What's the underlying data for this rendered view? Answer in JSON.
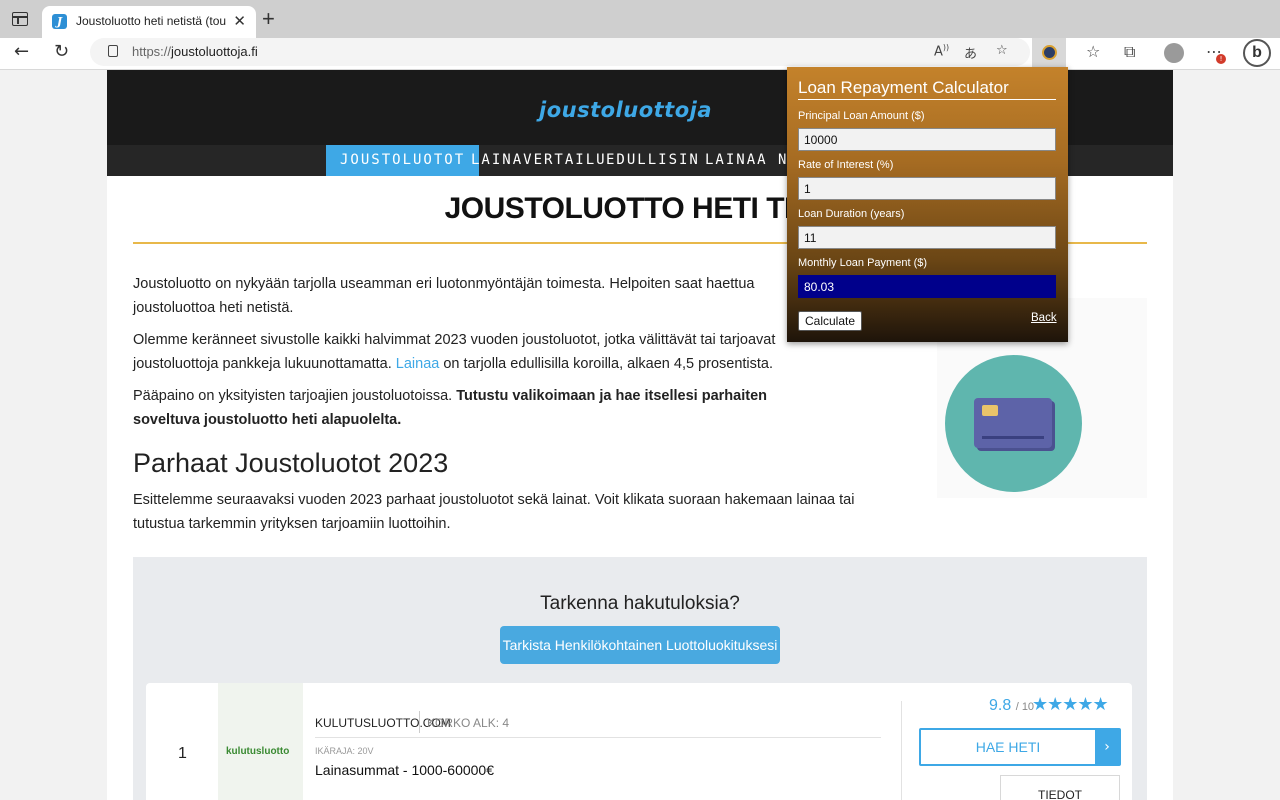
{
  "browser": {
    "tab_title": "Joustoluotto heti netistä (touko",
    "tab_favicon": "J",
    "url_protocol": "https://",
    "url_host": "joustoluottoja.fi",
    "bing_label": "b",
    "ext_badge": "!"
  },
  "site": {
    "logo": "joustoluottoja",
    "nav": [
      "JOUSTOLUOTOT",
      "LAINAVERTAILU",
      "EDULLISIN",
      "LAINAA NET"
    ],
    "page_title": "JOUSTOLUOTTO HETI TILIL",
    "paragraphs": {
      "p1": "Joustoluotto on nykyään tarjolla useamman eri luotonmyöntäjän toimesta. Helpoiten saat haettua joustoluottoa heti netistä.",
      "p2_pre": "Olemme keränneet sivustolle kaikki halvimmat 2023 vuoden joustoluotot, jotka välittävät tai tarjoavat joustoluottoja pankkeja lukuunottamatta. ",
      "p2_link": "Lainaa",
      "p2_post": " on tarjolla edullisilla koroilla, alkaen 4,5 prosentista.",
      "p3_pre": "Pääpaino on yksityisten tarjoajien joustoluotoissa. ",
      "p3_bold": "Tutustu valikoimaan ja hae itsellesi parhaiten soveltuva joustoluotto heti alapuolelta.",
      "p4": "Esittelemme seuraavaksi vuoden 2023 parhaat joustoluotot sekä lainat. Voit klikata suoraan hakemaan lainaa tai tutustua tarkemmin yrityksen tarjoamiin luottoihin."
    },
    "h2": "Parhaat Joustoluotot 2023",
    "filter": {
      "question": "Tarkenna hakutuloksia?",
      "button": "Tarkista Henkilökohtainen Luottoluokituksesi"
    },
    "result": {
      "rank": "1",
      "logo_text": "kulutusluotto",
      "name": "KULUTUSLUOTTO.COM",
      "korko": "KORKO ALK: 4",
      "ikaraja": "IKÄRAJA: 20V",
      "lainasummat": "Lainasummat - 1000-60000€",
      "score": "9.8",
      "score_max": "/ 10",
      "stars": "★★★★★",
      "rating_stars": 5,
      "apply": "HAE HETI",
      "apply_arrow": "›",
      "details": "TIEDOT"
    }
  },
  "calculator": {
    "title": "Loan Repayment Calculator",
    "principal_label": "Principal Loan Amount ($)",
    "principal_value": "10000",
    "rate_label": "Rate of Interest (%)",
    "rate_value": "1",
    "duration_label": "Loan Duration (years)",
    "duration_value": "11",
    "payment_label": "Monthly Loan Payment ($)",
    "payment_value": "80.03",
    "calculate_button": "Calculate",
    "back_link": "Back"
  }
}
